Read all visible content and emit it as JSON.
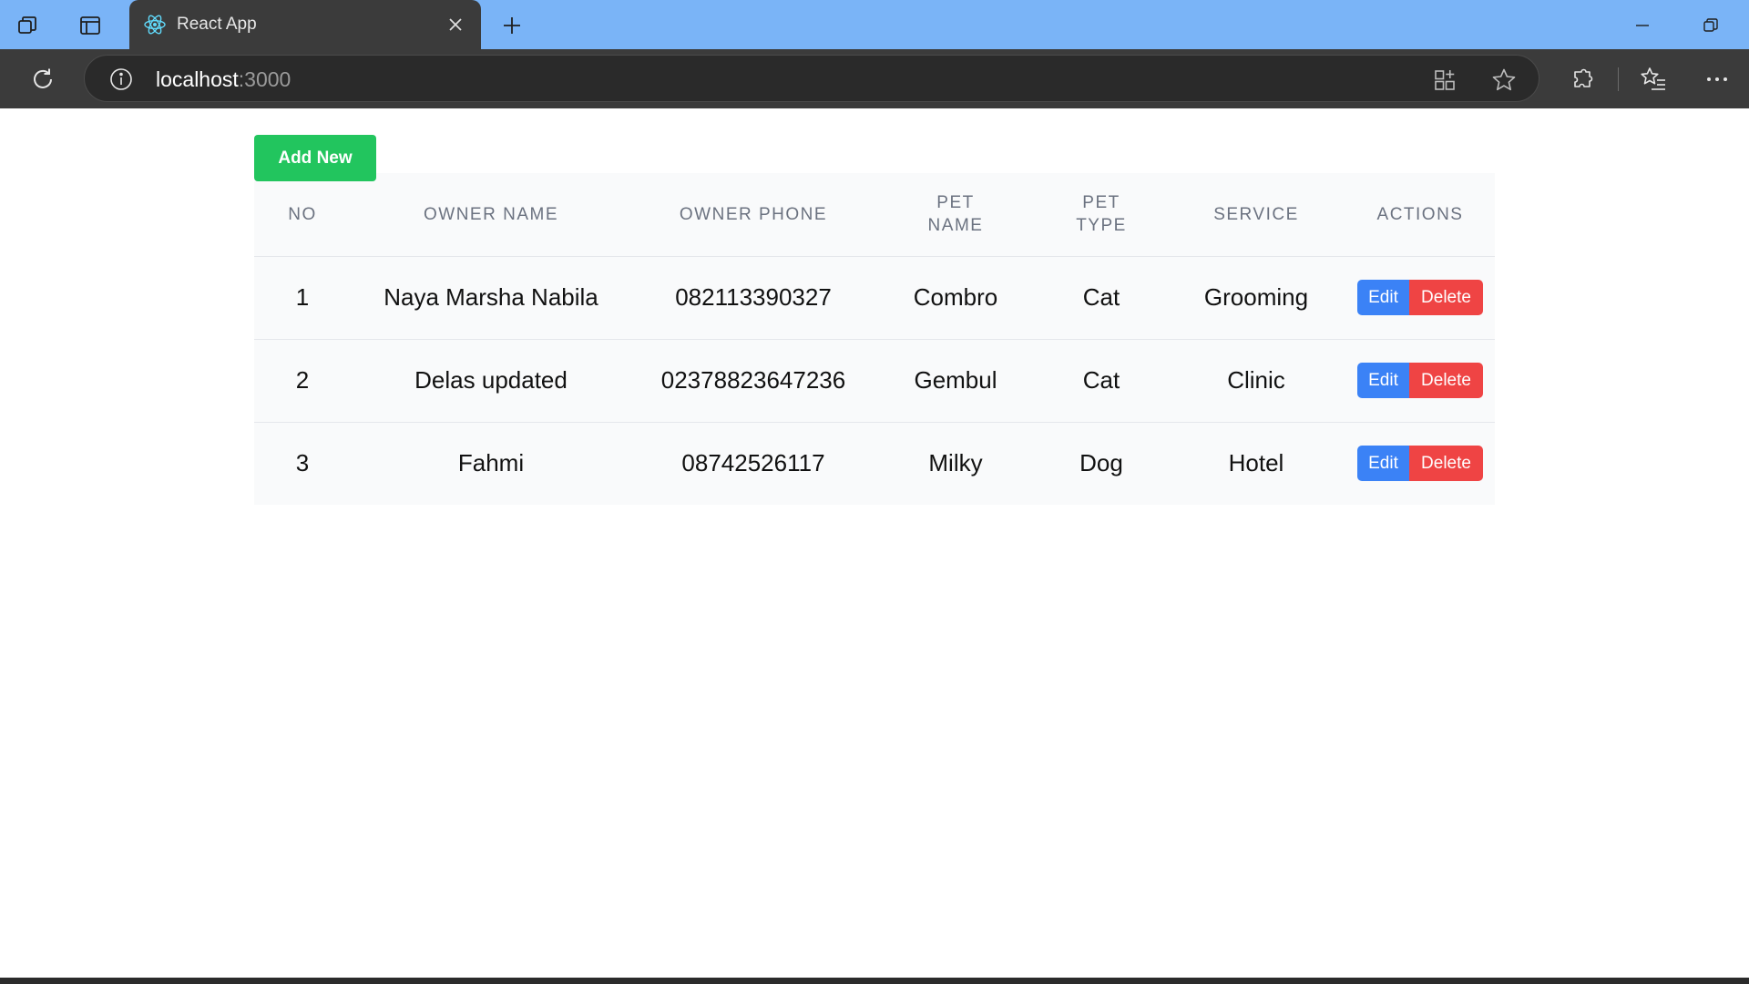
{
  "browser": {
    "tab_title": "React App",
    "url_host": "localhost",
    "url_port": ":3000"
  },
  "page": {
    "add_new_label": "Add New",
    "columns": [
      "NO",
      "OWNER NAME",
      "OWNER PHONE",
      "PET NAME",
      "PET TYPE",
      "SERVICE",
      "ACTIONS"
    ],
    "rows": [
      {
        "no": "1",
        "owner_name": "Naya Marsha Nabila",
        "owner_phone": "082113390327",
        "pet_name": "Combro",
        "pet_type": "Cat",
        "service": "Grooming"
      },
      {
        "no": "2",
        "owner_name": "Delas updated",
        "owner_phone": "02378823647236",
        "pet_name": "Gembul",
        "pet_type": "Cat",
        "service": "Clinic"
      },
      {
        "no": "3",
        "owner_name": "Fahmi",
        "owner_phone": "08742526117",
        "pet_name": "Milky",
        "pet_type": "Dog",
        "service": "Hotel"
      }
    ],
    "edit_label": "Edit",
    "delete_label": "Delete"
  },
  "colors": {
    "titlebar": "#7ab4f7",
    "toolbar": "#3b3b3b",
    "add_button": "#22c55e",
    "edit_button": "#3b82f6",
    "delete_button": "#ef4444",
    "table_bg": "#f9fafb"
  },
  "icons": {
    "workspaces": "workspaces-icon",
    "tab_actions": "tab-actions-icon",
    "favicon": "react-logo-icon",
    "close": "close-icon",
    "new_tab": "plus-icon",
    "minimize": "minimize-icon",
    "restore": "restore-icon",
    "reload": "reload-icon",
    "site_info": "info-icon",
    "app_available": "app-available-icon",
    "favorite": "star-icon",
    "extensions": "extensions-icon",
    "favorites": "favorites-icon",
    "more": "more-icon"
  }
}
